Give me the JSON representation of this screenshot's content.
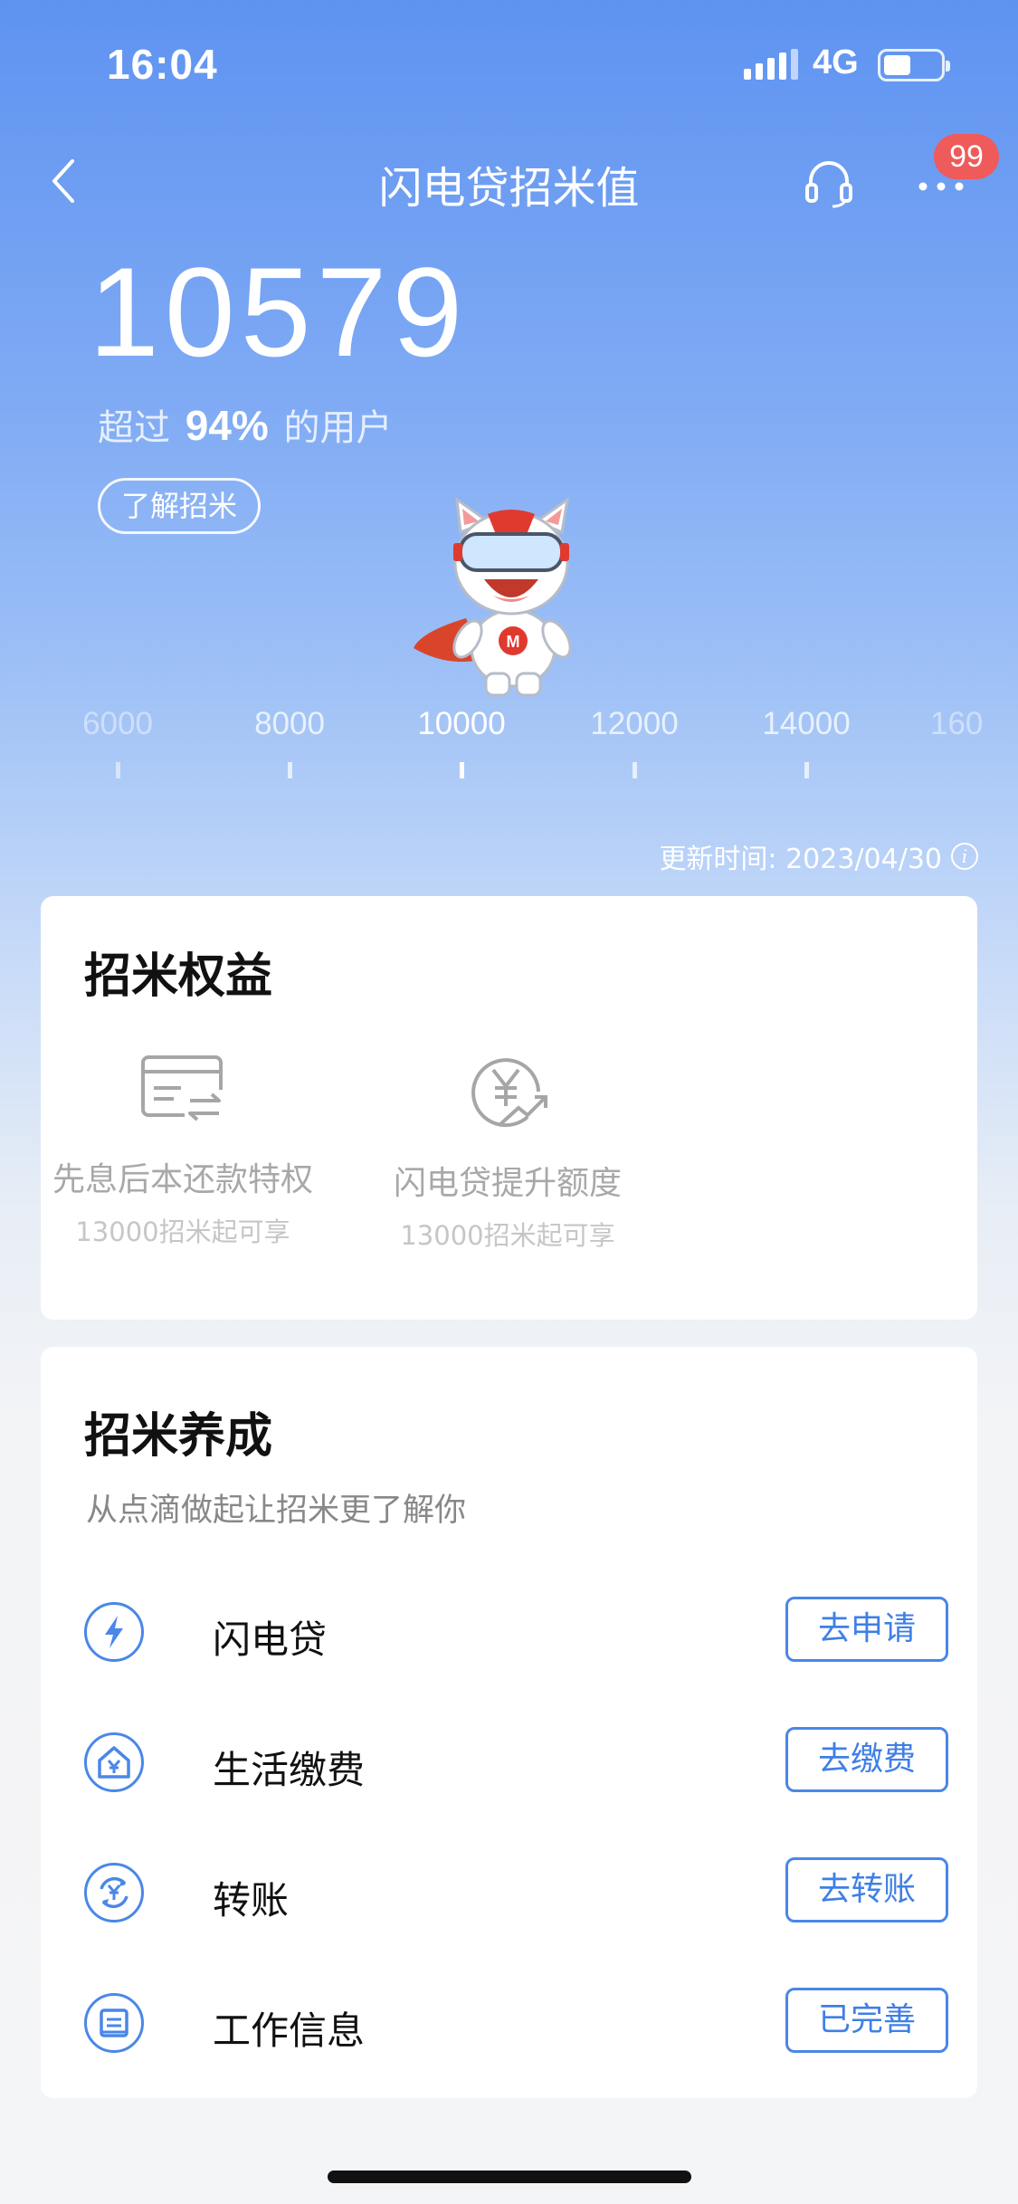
{
  "status_bar": {
    "time": "16:04",
    "network": "4G",
    "battery_level": 0.48
  },
  "nav": {
    "title": "闪电贷招米值",
    "badge": "99",
    "back_icon": "chevron-left-icon",
    "support_icon": "headset-icon",
    "more_icon": "more-dots-icon"
  },
  "score": {
    "value": "10579",
    "rank_prefix": "超过",
    "rank_percent": "94%",
    "rank_suffix": "的用户",
    "learn_button": "了解招米"
  },
  "scale": {
    "ticks": [
      "6000",
      "8000",
      "10000",
      "12000",
      "14000",
      "160"
    ],
    "current": "10000"
  },
  "update": {
    "label": "更新时间: 2023/04/30",
    "info_icon": "info-icon"
  },
  "benefits": {
    "title": "招米权益",
    "items": [
      {
        "name": "先息后本还款特权",
        "note": "13000招米起可享",
        "icon": "card-transfer-icon"
      },
      {
        "name": "闪电贷提升额度",
        "note": "13000招米起可享",
        "icon": "yen-up-icon"
      }
    ]
  },
  "nurture": {
    "title": "招米养成",
    "subtitle": "从点滴做起让招米更了解你",
    "items": [
      {
        "label": "闪电贷",
        "button": "去申请",
        "icon": "lightning-icon"
      },
      {
        "label": "生活缴费",
        "button": "去缴费",
        "icon": "home-yen-icon"
      },
      {
        "label": "转账",
        "button": "去转账",
        "icon": "yen-transfer-icon"
      },
      {
        "label": "工作信息",
        "button": "已完善",
        "icon": "document-icon"
      }
    ]
  },
  "colors": {
    "accent": "#4a87e8",
    "badge": "#ef5a5a",
    "header_top": "#5e93f1"
  }
}
